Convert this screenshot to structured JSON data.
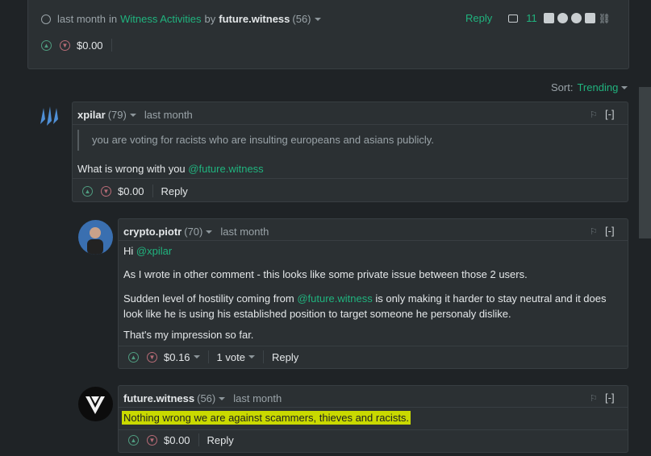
{
  "top_post": {
    "time": "last month",
    "in_label": "in",
    "category": "Witness Activities",
    "by_label": "by",
    "author": "future.witness",
    "reputation": "(56)",
    "payout": "$0.00",
    "reply_label": "Reply",
    "comment_count": "11"
  },
  "sort": {
    "label": "Sort:",
    "value": "Trending"
  },
  "comments": [
    {
      "author": "xpilar",
      "reputation": "(79)",
      "time": "last month",
      "quote": "you are voting for racists who are insulting europeans and asians publicly.",
      "body_text": "What is wrong with you ",
      "mention": "@future.witness",
      "payout": "$0.00",
      "reply_label": "Reply",
      "collapse_label": "[-]"
    },
    {
      "author": "crypto.piotr",
      "reputation": "(70)",
      "time": "last month",
      "greeting": "Hi ",
      "greeting_mention": "@xpilar",
      "para1": "As I wrote in other comment - this looks like some private issue between those 2 users.",
      "para2_a": "Sudden level of hostility coming from ",
      "para2_mention": "@future.witness",
      "para2_b": " is only making it harder to stay neutral and it does look like he is using his established position to target someone he personaly dislike.",
      "para3": "That's my impression so far.",
      "payout": "$0.16",
      "votes": "1 vote",
      "reply_label": "Reply",
      "collapse_label": "[-]"
    },
    {
      "author": "future.witness",
      "reputation": "(56)",
      "time": "last month",
      "body": "Nothing wrong we are against scammers, thieves and racists.",
      "payout": "$0.00",
      "reply_label": "Reply",
      "collapse_label": "[-]"
    }
  ],
  "colors": {
    "accent": "#20b37e",
    "link": "#4ba2f2",
    "highlight": "#c9d900"
  }
}
